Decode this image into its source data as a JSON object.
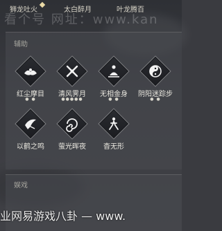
{
  "top_labels": [
    "狮龙吐火",
    "太白醉月",
    "叶龙腾百"
  ],
  "watermark": "看个号  网址：www.kan",
  "section1": {
    "title": "辅助",
    "skills": [
      {
        "name": "红尘摩目",
        "dots": "● ●",
        "icon": "lotus-icon"
      },
      {
        "name": "清风霁月",
        "dots": "●●●●●",
        "icon": "crossed-blades-icon"
      },
      {
        "name": "无相金身",
        "dots": "● ●",
        "icon": "meditating-figure-icon"
      },
      {
        "name": "阴阳迷踪步",
        "dots": "● ●",
        "icon": "yin-yang-icon"
      },
      {
        "name": "以鹤之鸣",
        "dots": "",
        "icon": "crane-icon"
      },
      {
        "name": "萤光晖夜",
        "dots": "",
        "icon": "swirl-icon"
      },
      {
        "name": "杳无形",
        "dots": "",
        "icon": "figure-icon"
      }
    ]
  },
  "section2": {
    "title": "娱戏"
  },
  "footer_watermark": "业网易游戏八卦 — www."
}
